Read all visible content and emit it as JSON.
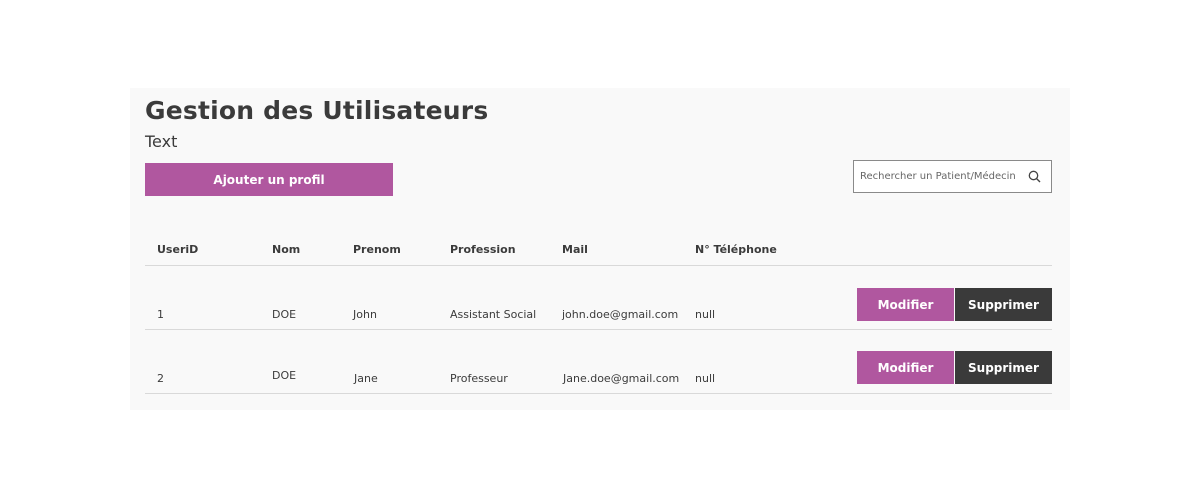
{
  "header": {
    "title": "Gestion des Utilisateurs",
    "subtitle": "Text"
  },
  "toolbar": {
    "add_label": "Ajouter un profil",
    "search_placeholder": "Rechercher un Patient/Médecin",
    "search_icon": "search-icon"
  },
  "table": {
    "columns": [
      "UseriD",
      "Nom",
      "Prenom",
      "Profession",
      "Mail",
      "N° Téléphone"
    ],
    "rows": [
      {
        "id": "1",
        "nom": "DOE",
        "prenom": "John",
        "profession": "Assistant Social",
        "mail": "john.doe@gmail.com",
        "tel": "null",
        "modify": "Modifier",
        "delete": "Supprimer"
      },
      {
        "id": "2",
        "nom": "DOE",
        "prenom": "Jane",
        "profession": "Professeur",
        "mail": "Jane.doe@gmail.com",
        "tel": "null",
        "modify": "Modifier",
        "delete": "Supprimer"
      }
    ]
  },
  "colors": {
    "accent": "#b0579f",
    "dark_button": "#3a3a3a",
    "panel_bg": "#f9f9f9"
  }
}
